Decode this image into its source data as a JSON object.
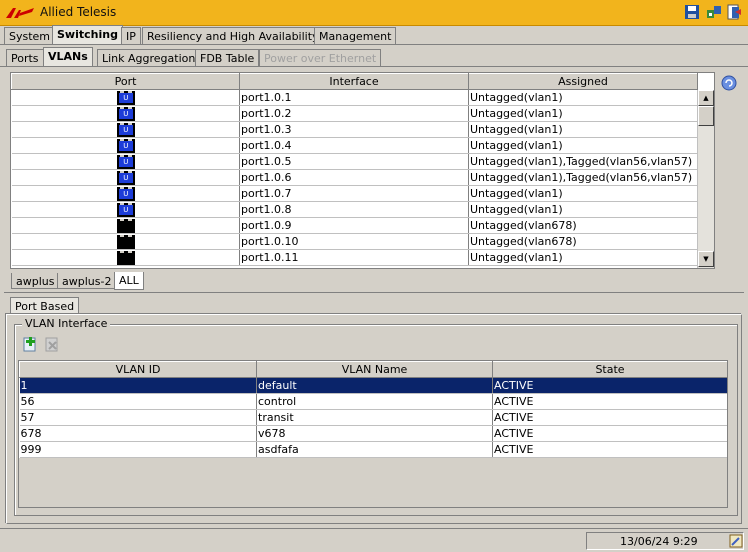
{
  "window": {
    "title": "Allied Telesis"
  },
  "main_tabs": [
    {
      "label": "System"
    },
    {
      "label": "Switching"
    },
    {
      "label": "IP"
    },
    {
      "label": "Resiliency and High Availability"
    },
    {
      "label": "Management"
    }
  ],
  "sub_tabs": [
    {
      "label": "Ports"
    },
    {
      "label": "VLANs"
    },
    {
      "label": "Link Aggregation"
    },
    {
      "label": "FDB Table"
    },
    {
      "label": "Power over Ethernet"
    }
  ],
  "ports_table": {
    "headers": {
      "port": "Port",
      "interface": "Interface",
      "assigned": "Assigned"
    },
    "rows": [
      {
        "icon": "U",
        "interface": "port1.0.1",
        "assigned": "Untagged(vlan1)"
      },
      {
        "icon": "U",
        "interface": "port1.0.2",
        "assigned": "Untagged(vlan1)"
      },
      {
        "icon": "U",
        "interface": "port1.0.3",
        "assigned": "Untagged(vlan1)"
      },
      {
        "icon": "U",
        "interface": "port1.0.4",
        "assigned": "Untagged(vlan1)"
      },
      {
        "icon": "U",
        "interface": "port1.0.5",
        "assigned": "Untagged(vlan1),Tagged(vlan56,vlan57)"
      },
      {
        "icon": "U",
        "interface": "port1.0.6",
        "assigned": "Untagged(vlan1),Tagged(vlan56,vlan57)"
      },
      {
        "icon": "U",
        "interface": "port1.0.7",
        "assigned": "Untagged(vlan1)"
      },
      {
        "icon": "U",
        "interface": "port1.0.8",
        "assigned": "Untagged(vlan1)"
      },
      {
        "icon": "",
        "interface": "port1.0.9",
        "assigned": "Untagged(vlan678)"
      },
      {
        "icon": "",
        "interface": "port1.0.10",
        "assigned": "Untagged(vlan678)"
      },
      {
        "icon": "",
        "interface": "port1.0.11",
        "assigned": "Untagged(vlan1)"
      }
    ]
  },
  "device_tabs": [
    {
      "label": "awplus"
    },
    {
      "label": "awplus-2"
    },
    {
      "label": "ALL"
    }
  ],
  "lower_tab": {
    "label": "Port Based"
  },
  "vlan_group": {
    "label": "VLAN Interface",
    "add_icon": "add-icon",
    "delete_icon": "delete-icon",
    "headers": {
      "id": "VLAN ID",
      "name": "VLAN Name",
      "state": "State"
    },
    "rows": [
      {
        "id": "1",
        "name": "default",
        "state": "ACTIVE"
      },
      {
        "id": "56",
        "name": "control",
        "state": "ACTIVE"
      },
      {
        "id": "57",
        "name": "transit",
        "state": "ACTIVE"
      },
      {
        "id": "678",
        "name": "v678",
        "state": "ACTIVE"
      },
      {
        "id": "999",
        "name": "asdfafa",
        "state": "ACTIVE"
      }
    ]
  },
  "status": {
    "datetime": "13/06/24 9:29"
  },
  "colors": {
    "titlebar": "#f2b41c",
    "selection": "#0a246a",
    "port_icon": "#1c3cd8"
  }
}
